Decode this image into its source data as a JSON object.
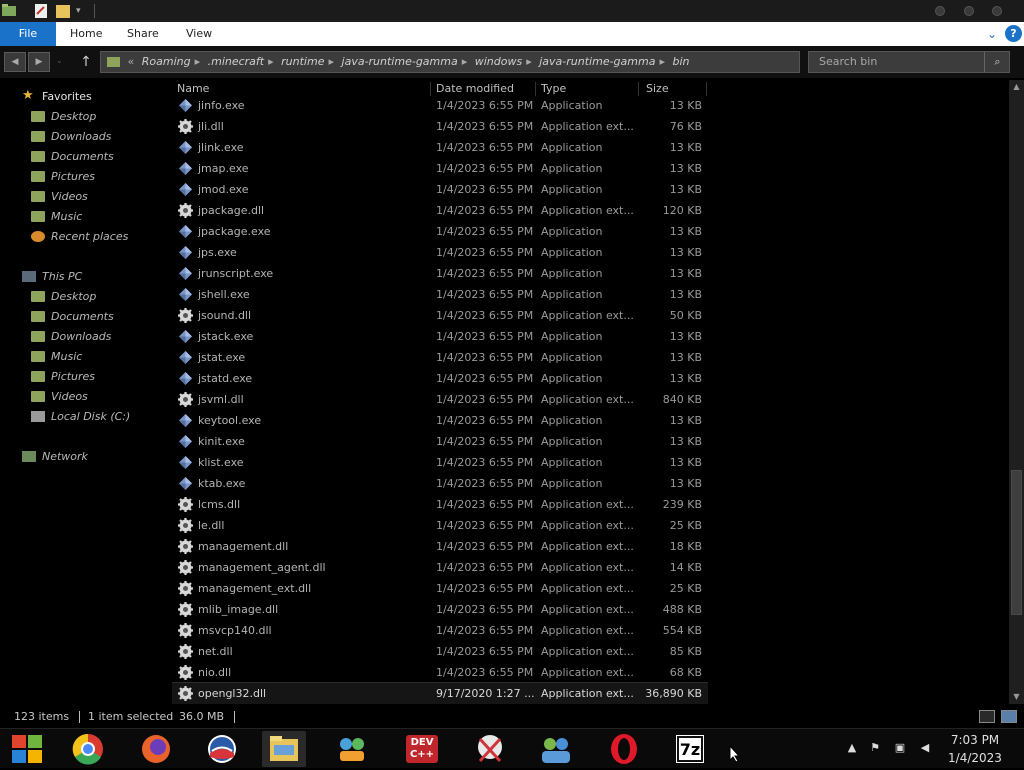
{
  "ribbon": {
    "tabs": [
      {
        "label": "File"
      },
      {
        "label": "Home"
      },
      {
        "label": "Share"
      },
      {
        "label": "View"
      }
    ]
  },
  "address": {
    "prefix": "«",
    "crumbs": [
      "Roaming",
      ".minecraft",
      "runtime",
      "java-runtime-gamma",
      "windows",
      "java-runtime-gamma",
      "bin"
    ]
  },
  "search": {
    "placeholder": "Search bin"
  },
  "nav": {
    "favorites_label": "Favorites",
    "favorites": [
      "Desktop",
      "Downloads",
      "Documents",
      "Pictures",
      "Videos",
      "Music",
      "Recent places"
    ],
    "thispc_label": "This PC",
    "thispc": [
      "Desktop",
      "Documents",
      "Downloads",
      "Music",
      "Pictures",
      "Videos",
      "Local Disk (C:)"
    ],
    "network_label": "Network"
  },
  "columns": {
    "name": "Name",
    "date": "Date modified",
    "type": "Type",
    "size": "Size"
  },
  "files": [
    {
      "name": "jinfo.exe",
      "date": "1/4/2023 6:55 PM",
      "type": "Application",
      "size": "13 KB",
      "icon": "exe-icon"
    },
    {
      "name": "jli.dll",
      "date": "1/4/2023 6:55 PM",
      "type": "Application ext...",
      "size": "76 KB",
      "icon": "dll-icon"
    },
    {
      "name": "jlink.exe",
      "date": "1/4/2023 6:55 PM",
      "type": "Application",
      "size": "13 KB",
      "icon": "exe-icon"
    },
    {
      "name": "jmap.exe",
      "date": "1/4/2023 6:55 PM",
      "type": "Application",
      "size": "13 KB",
      "icon": "exe-icon"
    },
    {
      "name": "jmod.exe",
      "date": "1/4/2023 6:55 PM",
      "type": "Application",
      "size": "13 KB",
      "icon": "exe-icon"
    },
    {
      "name": "jpackage.dll",
      "date": "1/4/2023 6:55 PM",
      "type": "Application ext...",
      "size": "120 KB",
      "icon": "dll-icon"
    },
    {
      "name": "jpackage.exe",
      "date": "1/4/2023 6:55 PM",
      "type": "Application",
      "size": "13 KB",
      "icon": "exe-icon"
    },
    {
      "name": "jps.exe",
      "date": "1/4/2023 6:55 PM",
      "type": "Application",
      "size": "13 KB",
      "icon": "exe-icon"
    },
    {
      "name": "jrunscript.exe",
      "date": "1/4/2023 6:55 PM",
      "type": "Application",
      "size": "13 KB",
      "icon": "exe-icon"
    },
    {
      "name": "jshell.exe",
      "date": "1/4/2023 6:55 PM",
      "type": "Application",
      "size": "13 KB",
      "icon": "exe-icon"
    },
    {
      "name": "jsound.dll",
      "date": "1/4/2023 6:55 PM",
      "type": "Application ext...",
      "size": "50 KB",
      "icon": "dll-icon"
    },
    {
      "name": "jstack.exe",
      "date": "1/4/2023 6:55 PM",
      "type": "Application",
      "size": "13 KB",
      "icon": "exe-icon"
    },
    {
      "name": "jstat.exe",
      "date": "1/4/2023 6:55 PM",
      "type": "Application",
      "size": "13 KB",
      "icon": "exe-icon"
    },
    {
      "name": "jstatd.exe",
      "date": "1/4/2023 6:55 PM",
      "type": "Application",
      "size": "13 KB",
      "icon": "exe-icon"
    },
    {
      "name": "jsvml.dll",
      "date": "1/4/2023 6:55 PM",
      "type": "Application ext...",
      "size": "840 KB",
      "icon": "dll-icon"
    },
    {
      "name": "keytool.exe",
      "date": "1/4/2023 6:55 PM",
      "type": "Application",
      "size": "13 KB",
      "icon": "exe-icon"
    },
    {
      "name": "kinit.exe",
      "date": "1/4/2023 6:55 PM",
      "type": "Application",
      "size": "13 KB",
      "icon": "exe-icon"
    },
    {
      "name": "klist.exe",
      "date": "1/4/2023 6:55 PM",
      "type": "Application",
      "size": "13 KB",
      "icon": "exe-icon"
    },
    {
      "name": "ktab.exe",
      "date": "1/4/2023 6:55 PM",
      "type": "Application",
      "size": "13 KB",
      "icon": "exe-icon"
    },
    {
      "name": "lcms.dll",
      "date": "1/4/2023 6:55 PM",
      "type": "Application ext...",
      "size": "239 KB",
      "icon": "dll-icon"
    },
    {
      "name": "le.dll",
      "date": "1/4/2023 6:55 PM",
      "type": "Application ext...",
      "size": "25 KB",
      "icon": "dll-icon"
    },
    {
      "name": "management.dll",
      "date": "1/4/2023 6:55 PM",
      "type": "Application ext...",
      "size": "18 KB",
      "icon": "dll-icon"
    },
    {
      "name": "management_agent.dll",
      "date": "1/4/2023 6:55 PM",
      "type": "Application ext...",
      "size": "14 KB",
      "icon": "dll-icon"
    },
    {
      "name": "management_ext.dll",
      "date": "1/4/2023 6:55 PM",
      "type": "Application ext...",
      "size": "25 KB",
      "icon": "dll-icon"
    },
    {
      "name": "mlib_image.dll",
      "date": "1/4/2023 6:55 PM",
      "type": "Application ext...",
      "size": "488 KB",
      "icon": "dll-icon"
    },
    {
      "name": "msvcp140.dll",
      "date": "1/4/2023 6:55 PM",
      "type": "Application ext...",
      "size": "554 KB",
      "icon": "dll-icon"
    },
    {
      "name": "net.dll",
      "date": "1/4/2023 6:55 PM",
      "type": "Application ext...",
      "size": "85 KB",
      "icon": "dll-icon"
    },
    {
      "name": "nio.dll",
      "date": "1/4/2023 6:55 PM",
      "type": "Application ext...",
      "size": "68 KB",
      "icon": "dll-icon"
    },
    {
      "name": "opengl32.dll",
      "date": "9/17/2020 1:27 ...",
      "type": "Application ext...",
      "size": "36,890 KB",
      "icon": "dll-icon",
      "selected": true
    }
  ],
  "status": {
    "items": "123 items",
    "selected": "1 item selected",
    "size": "36.0 MB"
  },
  "taskbar": {
    "apps": [
      "start-icon",
      "chrome-icon",
      "firefox-icon",
      "obama-logo-icon",
      "file-explorer-icon",
      "network-people-icon",
      "dev-cpp-icon",
      "scissors-icon",
      "people-icon",
      "opera-icon",
      "7zip-icon"
    ],
    "dev_label": "DEV C++",
    "sevenzip_label": "7z",
    "time": "7:03 PM",
    "date": "1/4/2023"
  },
  "colors": {
    "accent": "#1a73c9",
    "background": "#000000"
  }
}
